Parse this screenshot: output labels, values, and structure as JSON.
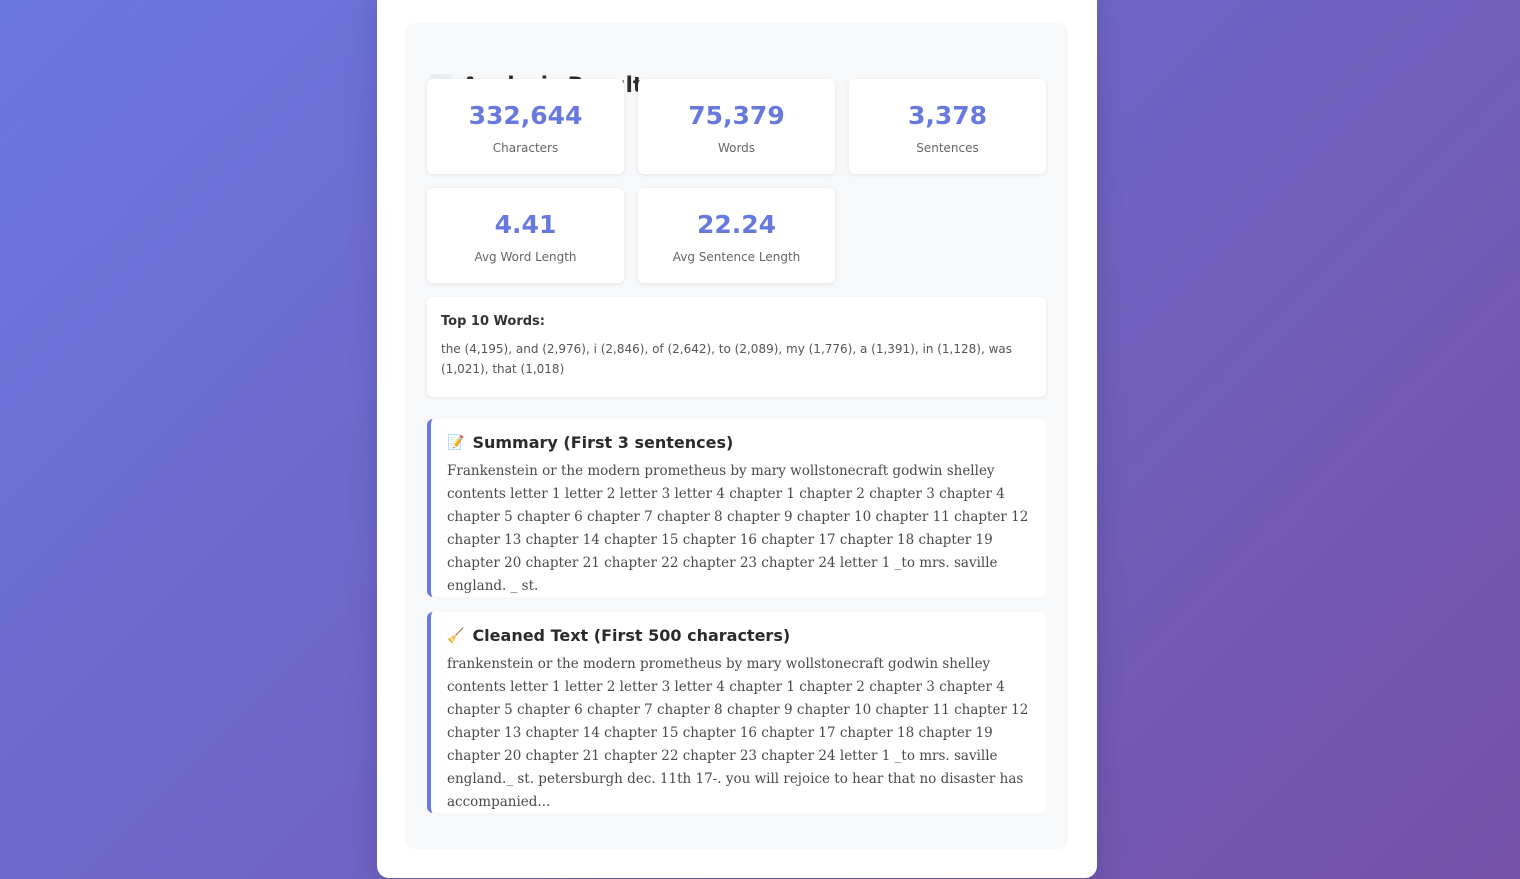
{
  "results": {
    "title": "Analysis Results",
    "stats": [
      {
        "value": "332,644",
        "label": "Characters"
      },
      {
        "value": "75,379",
        "label": "Words"
      },
      {
        "value": "3,378",
        "label": "Sentences"
      },
      {
        "value": "4.41",
        "label": "Avg Word Length"
      },
      {
        "value": "22.24",
        "label": "Avg Sentence Length"
      }
    ],
    "top_words": {
      "title": "Top 10 Words:",
      "text": "the (4,195), and (2,976), i (2,846), of (2,642), to (2,089), my (1,776), a (1,391), in (1,128), was (1,021), that (1,018)"
    },
    "summary": {
      "icon": "📝",
      "title": "Summary (First 3 sentences)",
      "text": "Frankenstein or the modern prometheus by mary wollstonecraft godwin shelley contents letter 1 letter 2 letter 3 letter 4 chapter 1 chapter 2 chapter 3 chapter 4 chapter 5 chapter 6 chapter 7 chapter 8 chapter 9 chapter 10 chapter 11 chapter 12 chapter 13 chapter 14 chapter 15 chapter 16 chapter 17 chapter 18 chapter 19 chapter 20 chapter 21 chapter 22 chapter 23 chapter 24 letter 1 _to mrs. saville england. _ st."
    },
    "cleaned": {
      "icon": "🧹",
      "title": "Cleaned Text (First 500 characters)",
      "text": "frankenstein or the modern prometheus by mary wollstonecraft godwin shelley contents letter 1 letter 2 letter 3 letter 4 chapter 1 chapter 2 chapter 3 chapter 4 chapter 5 chapter 6 chapter 7 chapter 8 chapter 9 chapter 10 chapter 11 chapter 12 chapter 13 chapter 14 chapter 15 chapter 16 chapter 17 chapter 18 chapter 19 chapter 20 chapter 21 chapter 22 chapter 23 chapter 24 letter 1 _to mrs. saville england._ st. petersburgh dec. 11th 17-. you will rejoice to hear that no disaster has accompanied..."
    }
  },
  "colors": {
    "accent": "#6779df",
    "background_start": "#6a77df",
    "background_end": "#7450a8"
  }
}
